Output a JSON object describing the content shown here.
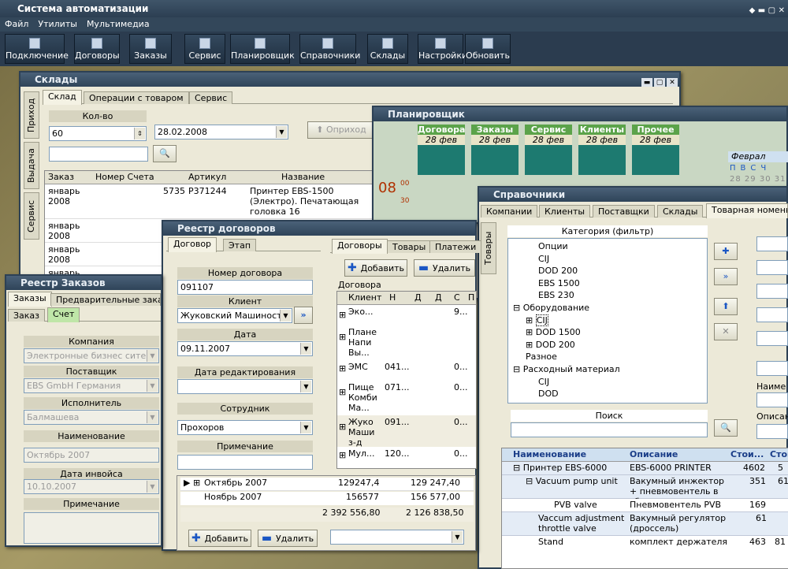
{
  "app": {
    "title": "Система автоматизации",
    "menu": [
      "Файл",
      "Утилиты",
      "Мультимедиа"
    ]
  },
  "toolbar": [
    "Подключение",
    "Договоры",
    "Заказы",
    "Сервис",
    "Планировщик",
    "Справочники",
    "Склады",
    "Настройки",
    "Обновить"
  ],
  "sklady": {
    "title": "Склады",
    "tabs": [
      "Склад",
      "Операции с товаром",
      "Сервис"
    ],
    "side_tabs": [
      "Приход",
      "Выдача",
      "Сервис"
    ],
    "qty_label": "Кол-во",
    "qty_value": "60",
    "date": "28.02.2008",
    "incoming_btn": "Оприход",
    "columns": [
      "Заказ",
      "Номер Счета",
      "Артикул",
      "Название"
    ],
    "rows": [
      {
        "order": "январь 2008",
        "invoice": "5735",
        "article": "P371244",
        "name": "Принтер EBS-1500 (Электро). Печатающая головка 16"
      },
      {
        "order": "январь 2008"
      },
      {
        "order": "январь 2008"
      },
      {
        "order": "январь 2008"
      }
    ]
  },
  "planner": {
    "title": "Планировщик",
    "columns": [
      "Договора",
      "Заказы",
      "Сервис",
      "Клиенты",
      "Прочее"
    ],
    "date": "28 фев",
    "time_hour": "08",
    "time_min1": "00",
    "time_min2": "30",
    "month": "Феврал",
    "weekdays": [
      "П",
      "В",
      "С",
      "Ч"
    ],
    "days": [
      "28",
      "29",
      "30",
      "31"
    ]
  },
  "sprav": {
    "title": "Справочники",
    "tabs": [
      "Компании",
      "Клиенты",
      "Поставщки",
      "Склады",
      "Товарная номенк"
    ],
    "side_tab": "Товары",
    "filter_label": "Категория (фильтр)",
    "tree": [
      "Опции",
      "CIJ",
      "DOD 200",
      "EBS 1500",
      "EBS 230",
      "Оборудование",
      "CIJ",
      "DOD 1500",
      "DOD 200",
      "Разное",
      "Расходный материал",
      "CIJ",
      "DOD"
    ],
    "search_label": "Поиск",
    "right_labels": [
      "Наиме",
      "Описан"
    ],
    "grid_cols": [
      "Наименование",
      "Описание",
      "Стои...",
      "Стои"
    ],
    "grid_rows": [
      {
        "name": "Принтер EBS-6000",
        "desc": "EBS-6000 PRINTER",
        "c1": "4602",
        "c2": "5"
      },
      {
        "name": "Vacuum pump unit",
        "desc": "Вакумный инжектор + пневмовентель в сборе",
        "c1": "351",
        "c2": "61"
      },
      {
        "name": "PVB valve",
        "desc": "Пневмовентель PVB",
        "c1": "169",
        "c2": ""
      },
      {
        "name": "Vaccum adjustment throttle valve",
        "desc": "Вакумный регулятор (дроссель)",
        "c1": "61",
        "c2": ""
      },
      {
        "name": "Stand",
        "desc": "комплект держателя",
        "c1": "463",
        "c2": "81"
      }
    ]
  },
  "zakazy": {
    "title": "Реестр Заказов",
    "tabs": [
      "Заказы",
      "Предварительные заказы"
    ],
    "subtabs": [
      "Заказ",
      "Счет"
    ],
    "fields": [
      {
        "label": "Компания",
        "value": "Электронные бизнес сите"
      },
      {
        "label": "Поставщик",
        "value": "EBS GmbH Германия"
      },
      {
        "label": "Исполнитель",
        "value": "Балмашева"
      },
      {
        "label": "Наименование",
        "value": "Октябрь 2007"
      },
      {
        "label": "Дата инвойса",
        "value": "10.10.2007"
      },
      {
        "label": "Примечание",
        "value": ""
      }
    ]
  },
  "dogovory": {
    "title": "Реестр договоров",
    "tabs": [
      "Договор",
      "Этап"
    ],
    "fields": [
      {
        "label": "Номер договора",
        "value": "091107"
      },
      {
        "label": "Клиент",
        "value": "Жуковский Машиност"
      },
      {
        "label": "Дата",
        "value": "09.11.2007"
      },
      {
        "label": "Дата редактирования",
        "value": ""
      },
      {
        "label": "Сотрудник",
        "value": "Прохоров"
      },
      {
        "label": "Примечание",
        "value": ""
      }
    ],
    "right_tabs": [
      "Договоры",
      "Товары",
      "Платежи"
    ],
    "add": "Добавить",
    "delete": "Удалить",
    "group_label": "Договора",
    "grid_cols": [
      "Клиент",
      "Н",
      "Д",
      "Д",
      "С",
      "П"
    ],
    "grid_rows": [
      {
        "c": "Эко...",
        "n": "",
        "s": "9..."
      },
      {
        "c": "Плане Напи Вы...",
        "n": "",
        "s": ""
      },
      {
        "c": "ЭМС",
        "n": "041...",
        "s": "0..."
      },
      {
        "c": "Пище Комби Ма...",
        "n": "071...",
        "s": "0..."
      },
      {
        "c": "Жуко Маши з-д",
        "n": "091...",
        "s": "0..."
      },
      {
        "c": "Мул...",
        "n": "120...",
        "s": "0..."
      }
    ]
  },
  "totals": {
    "rows": [
      {
        "m": "Октябрь 2007",
        "a": "129247,4",
        "b": "129 247,40"
      },
      {
        "m": "Ноябрь 2007",
        "a": "156577",
        "b": "156 577,00"
      }
    ],
    "sum_a": "2 392 556,80",
    "sum_b": "2 126 838,50",
    "add": "Добавить",
    "delete": "Удалить"
  }
}
